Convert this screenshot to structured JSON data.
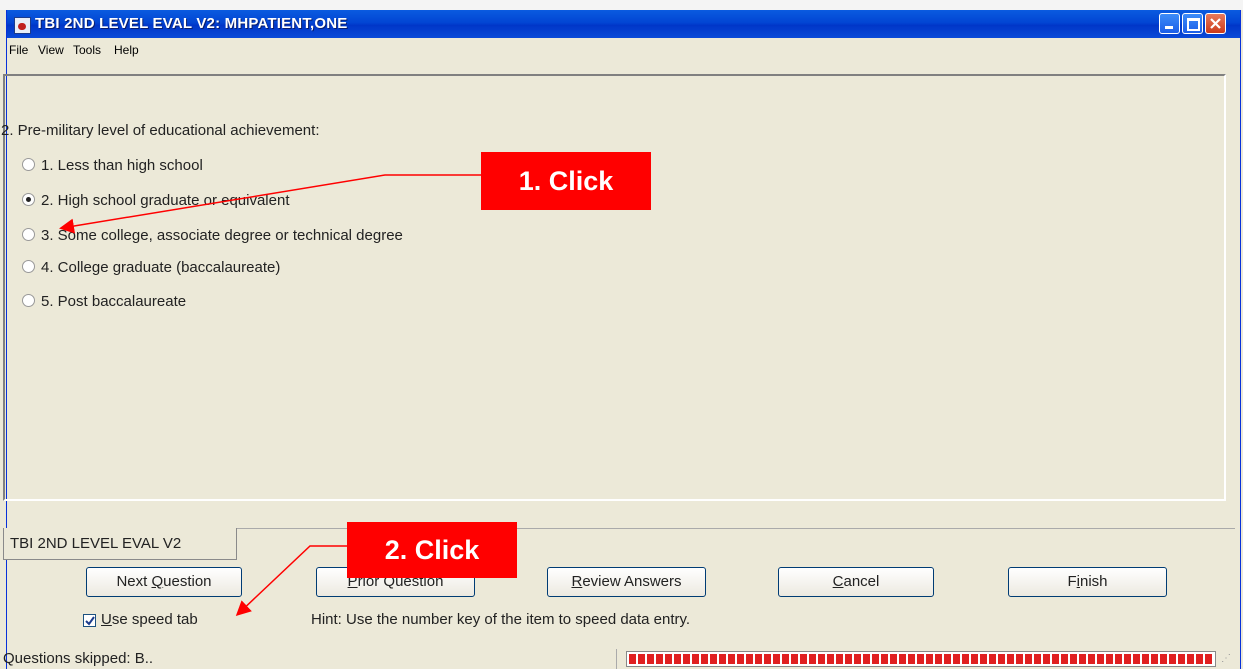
{
  "window": {
    "title": "TBI 2ND LEVEL EVAL V2: MHPATIENT,ONE"
  },
  "menu": [
    "File",
    "View",
    "Tools",
    "Help"
  ],
  "question": {
    "text": "2. Pre-military level of educational achievement:",
    "options": [
      {
        "label": "1. Less than high school",
        "selected": false
      },
      {
        "label": "2. High school graduate or equivalent",
        "selected": true
      },
      {
        "label": "3. Some college, associate degree or technical degree",
        "selected": false
      },
      {
        "label": "4. College graduate (baccalaureate)",
        "selected": false
      },
      {
        "label": "5. Post baccalaureate",
        "selected": false
      }
    ]
  },
  "tab": {
    "label": "TBI 2ND LEVEL EVAL V2"
  },
  "buttons": {
    "next": {
      "pre": "Next ",
      "key": "Q",
      "post": "uestion"
    },
    "prior": {
      "pre": "",
      "key": "P",
      "post": "rior Question"
    },
    "review": {
      "pre": "",
      "key": "R",
      "post": "eview Answers"
    },
    "cancel": {
      "pre": "",
      "key": "C",
      "post": "ancel"
    },
    "finish": {
      "pre": "F",
      "key": "i",
      "post": "nish"
    }
  },
  "speed_tab": {
    "key": "U",
    "post": "se speed tab",
    "checked": true
  },
  "hint": "Hint: Use the number key of the item to speed data entry.",
  "status": {
    "text": "Questions skipped: B..",
    "progress": 1.0
  },
  "annotations": {
    "click1": "1. Click",
    "click2": "2. Click",
    "color": "#ff0000"
  }
}
